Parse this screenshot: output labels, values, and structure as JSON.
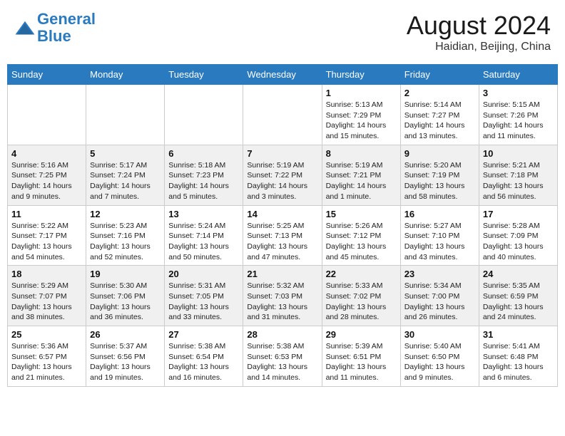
{
  "header": {
    "logo_line1": "General",
    "logo_line2": "Blue",
    "month_year": "August 2024",
    "location": "Haidian, Beijing, China"
  },
  "weekdays": [
    "Sunday",
    "Monday",
    "Tuesday",
    "Wednesday",
    "Thursday",
    "Friday",
    "Saturday"
  ],
  "weeks": [
    [
      {
        "day": "",
        "info": ""
      },
      {
        "day": "",
        "info": ""
      },
      {
        "day": "",
        "info": ""
      },
      {
        "day": "",
        "info": ""
      },
      {
        "day": "1",
        "info": "Sunrise: 5:13 AM\nSunset: 7:29 PM\nDaylight: 14 hours\nand 15 minutes."
      },
      {
        "day": "2",
        "info": "Sunrise: 5:14 AM\nSunset: 7:27 PM\nDaylight: 14 hours\nand 13 minutes."
      },
      {
        "day": "3",
        "info": "Sunrise: 5:15 AM\nSunset: 7:26 PM\nDaylight: 14 hours\nand 11 minutes."
      }
    ],
    [
      {
        "day": "4",
        "info": "Sunrise: 5:16 AM\nSunset: 7:25 PM\nDaylight: 14 hours\nand 9 minutes."
      },
      {
        "day": "5",
        "info": "Sunrise: 5:17 AM\nSunset: 7:24 PM\nDaylight: 14 hours\nand 7 minutes."
      },
      {
        "day": "6",
        "info": "Sunrise: 5:18 AM\nSunset: 7:23 PM\nDaylight: 14 hours\nand 5 minutes."
      },
      {
        "day": "7",
        "info": "Sunrise: 5:19 AM\nSunset: 7:22 PM\nDaylight: 14 hours\nand 3 minutes."
      },
      {
        "day": "8",
        "info": "Sunrise: 5:19 AM\nSunset: 7:21 PM\nDaylight: 14 hours\nand 1 minute."
      },
      {
        "day": "9",
        "info": "Sunrise: 5:20 AM\nSunset: 7:19 PM\nDaylight: 13 hours\nand 58 minutes."
      },
      {
        "day": "10",
        "info": "Sunrise: 5:21 AM\nSunset: 7:18 PM\nDaylight: 13 hours\nand 56 minutes."
      }
    ],
    [
      {
        "day": "11",
        "info": "Sunrise: 5:22 AM\nSunset: 7:17 PM\nDaylight: 13 hours\nand 54 minutes."
      },
      {
        "day": "12",
        "info": "Sunrise: 5:23 AM\nSunset: 7:16 PM\nDaylight: 13 hours\nand 52 minutes."
      },
      {
        "day": "13",
        "info": "Sunrise: 5:24 AM\nSunset: 7:14 PM\nDaylight: 13 hours\nand 50 minutes."
      },
      {
        "day": "14",
        "info": "Sunrise: 5:25 AM\nSunset: 7:13 PM\nDaylight: 13 hours\nand 47 minutes."
      },
      {
        "day": "15",
        "info": "Sunrise: 5:26 AM\nSunset: 7:12 PM\nDaylight: 13 hours\nand 45 minutes."
      },
      {
        "day": "16",
        "info": "Sunrise: 5:27 AM\nSunset: 7:10 PM\nDaylight: 13 hours\nand 43 minutes."
      },
      {
        "day": "17",
        "info": "Sunrise: 5:28 AM\nSunset: 7:09 PM\nDaylight: 13 hours\nand 40 minutes."
      }
    ],
    [
      {
        "day": "18",
        "info": "Sunrise: 5:29 AM\nSunset: 7:07 PM\nDaylight: 13 hours\nand 38 minutes."
      },
      {
        "day": "19",
        "info": "Sunrise: 5:30 AM\nSunset: 7:06 PM\nDaylight: 13 hours\nand 36 minutes."
      },
      {
        "day": "20",
        "info": "Sunrise: 5:31 AM\nSunset: 7:05 PM\nDaylight: 13 hours\nand 33 minutes."
      },
      {
        "day": "21",
        "info": "Sunrise: 5:32 AM\nSunset: 7:03 PM\nDaylight: 13 hours\nand 31 minutes."
      },
      {
        "day": "22",
        "info": "Sunrise: 5:33 AM\nSunset: 7:02 PM\nDaylight: 13 hours\nand 28 minutes."
      },
      {
        "day": "23",
        "info": "Sunrise: 5:34 AM\nSunset: 7:00 PM\nDaylight: 13 hours\nand 26 minutes."
      },
      {
        "day": "24",
        "info": "Sunrise: 5:35 AM\nSunset: 6:59 PM\nDaylight: 13 hours\nand 24 minutes."
      }
    ],
    [
      {
        "day": "25",
        "info": "Sunrise: 5:36 AM\nSunset: 6:57 PM\nDaylight: 13 hours\nand 21 minutes."
      },
      {
        "day": "26",
        "info": "Sunrise: 5:37 AM\nSunset: 6:56 PM\nDaylight: 13 hours\nand 19 minutes."
      },
      {
        "day": "27",
        "info": "Sunrise: 5:38 AM\nSunset: 6:54 PM\nDaylight: 13 hours\nand 16 minutes."
      },
      {
        "day": "28",
        "info": "Sunrise: 5:38 AM\nSunset: 6:53 PM\nDaylight: 13 hours\nand 14 minutes."
      },
      {
        "day": "29",
        "info": "Sunrise: 5:39 AM\nSunset: 6:51 PM\nDaylight: 13 hours\nand 11 minutes."
      },
      {
        "day": "30",
        "info": "Sunrise: 5:40 AM\nSunset: 6:50 PM\nDaylight: 13 hours\nand 9 minutes."
      },
      {
        "day": "31",
        "info": "Sunrise: 5:41 AM\nSunset: 6:48 PM\nDaylight: 13 hours\nand 6 minutes."
      }
    ]
  ]
}
